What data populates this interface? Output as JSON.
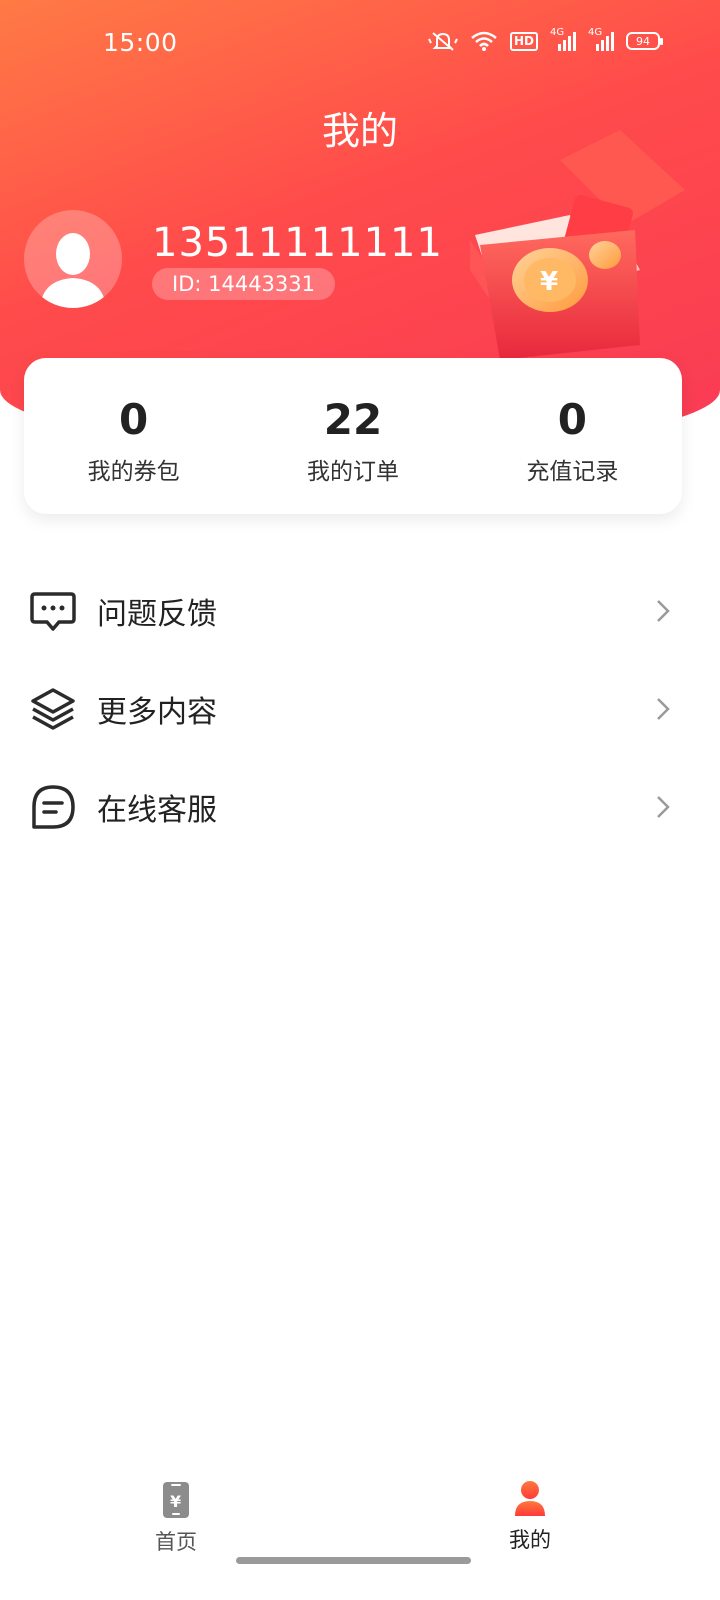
{
  "status_bar": {
    "time": "15:00",
    "hd_label": "HD",
    "network_labels": [
      "4G",
      "4G"
    ],
    "battery": "94",
    "icons": [
      "mute-vibrate-icon",
      "wifi-icon",
      "hd-icon",
      "signal-icon",
      "signal-icon",
      "battery-icon"
    ]
  },
  "header": {
    "title": "我的",
    "decoration_icon": "gift-box-coins-icon"
  },
  "user": {
    "phone": "13511111111",
    "id_label": "ID: 14443331",
    "avatar_icon": "default-user-avatar-icon"
  },
  "stats": [
    {
      "value": "0",
      "label": "我的券包"
    },
    {
      "value": "22",
      "label": "我的订单"
    },
    {
      "value": "0",
      "label": "充值记录"
    }
  ],
  "menu": [
    {
      "label": "问题反馈",
      "icon": "feedback-icon"
    },
    {
      "label": "更多内容",
      "icon": "layers-icon"
    },
    {
      "label": "在线客服",
      "icon": "chat-icon"
    }
  ],
  "tabbar": {
    "home_label": "首页",
    "mine_label": "我的",
    "active": "我的"
  },
  "colors": {
    "header_start": "#ff7a45",
    "header_end": "#f93a55",
    "active_tab": "#ff4b2b"
  }
}
